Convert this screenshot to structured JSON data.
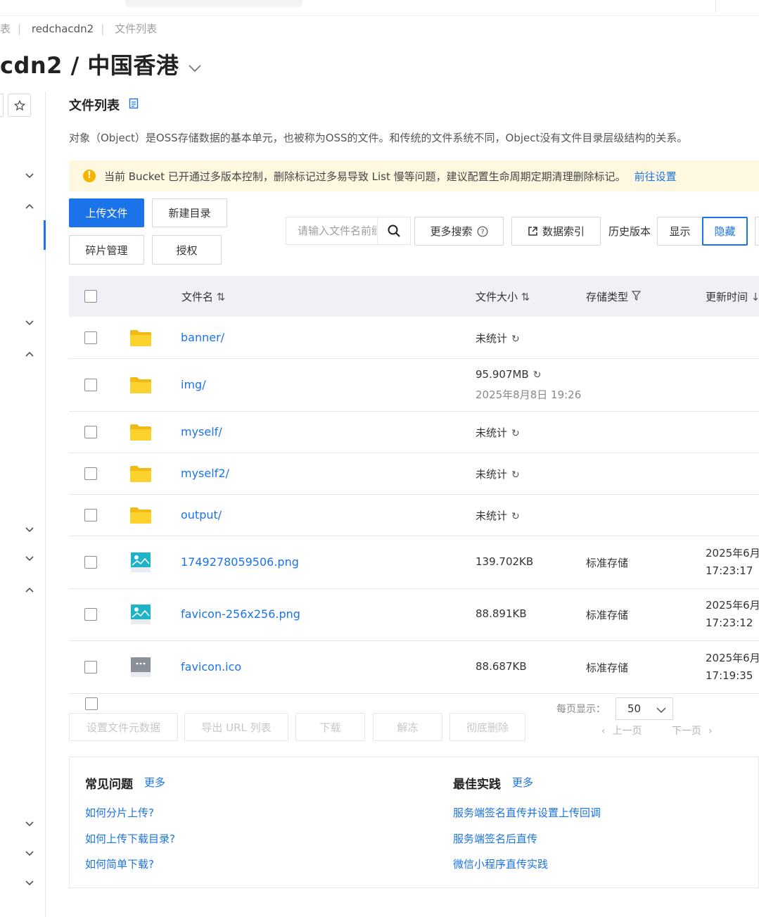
{
  "breadcrumb": {
    "partial": "表",
    "bucket": "redchacdn2",
    "current": "文件列表"
  },
  "page_title": "cdn2 / 中国香港",
  "section": {
    "title": "文件列表",
    "description": "对象（Object）是OSS存储数据的基本单元，也被称为OSS的文件。和传统的文件系统不同，Object没有文件目录层级结构的关系。"
  },
  "notice": {
    "icon": "warning-icon",
    "text": "当前 Bucket 已开通过多版本控制，删除标记过多易导致 List 慢等问题，建议配置生命周期定期清理删除标记。",
    "link": "前往设置"
  },
  "toolbar": {
    "upload": "上传文件",
    "new_dir": "新建目录",
    "fragments": "碎片管理",
    "authorize": "授权",
    "search_placeholder": "请输入文件名前缀",
    "more_search": "更多搜索",
    "data_index": "数据索引",
    "history_label": "历史版本",
    "show": "显示",
    "hide": "隐藏",
    "history_selected": "hide"
  },
  "table": {
    "columns": {
      "name": "文件名",
      "size": "文件大小",
      "storage": "存储类型",
      "updated": "更新时间"
    },
    "rows": [
      {
        "type": "folder",
        "name": "banner/",
        "size": "未统计",
        "refresh": true,
        "storage": "",
        "updated_date": "",
        "updated_time": ""
      },
      {
        "type": "folder",
        "name": "img/",
        "size": "95.907MB",
        "refresh": true,
        "size_note": "2025年8月8日 19:26",
        "storage": "",
        "updated_date": "",
        "updated_time": ""
      },
      {
        "type": "folder",
        "name": "myself/",
        "size": "未统计",
        "refresh": true,
        "storage": "",
        "updated_date": "",
        "updated_time": ""
      },
      {
        "type": "folder",
        "name": "myself2/",
        "size": "未统计",
        "refresh": true,
        "storage": "",
        "updated_date": "",
        "updated_time": ""
      },
      {
        "type": "folder",
        "name": "output/",
        "size": "未统计",
        "refresh": true,
        "storage": "",
        "updated_date": "",
        "updated_time": ""
      },
      {
        "type": "image",
        "name": "1749278059506.png",
        "size": "139.702KB",
        "storage": "标准存储",
        "updated_date": "2025年6月",
        "updated_time": "17:23:17"
      },
      {
        "type": "image",
        "name": "favicon-256x256.png",
        "size": "88.891KB",
        "storage": "标准存储",
        "updated_date": "2025年6月",
        "updated_time": "17:23:12"
      },
      {
        "type": "file",
        "name": "favicon.ico",
        "size": "88.687KB",
        "storage": "标准存储",
        "updated_date": "2025年6月",
        "updated_time": "17:19:35"
      }
    ]
  },
  "bulk_actions": {
    "set_meta": "设置文件元数据",
    "export_url": "导出 URL 列表",
    "download": "下载",
    "unfreeze": "解冻",
    "delete": "彻底删除"
  },
  "pager": {
    "per_page_label": "每页显示：",
    "per_page_value": "50",
    "prev": "上一页",
    "next": "下一页"
  },
  "help": {
    "faq": {
      "title": "常见问题",
      "more": "更多",
      "links": [
        "如何分片上传?",
        "如何上传下载目录?",
        "如何简单下载?"
      ]
    },
    "best": {
      "title": "最佳实践",
      "more": "更多",
      "links": [
        "服务端签名直传并设置上传回调",
        "服务端签名后直传",
        "微信小程序直传实践"
      ]
    }
  },
  "colors": {
    "accent": "#1a73e8",
    "notice_bg": "#fff8e1",
    "folder": "#f9c623",
    "header_bg": "#eff1f6"
  }
}
